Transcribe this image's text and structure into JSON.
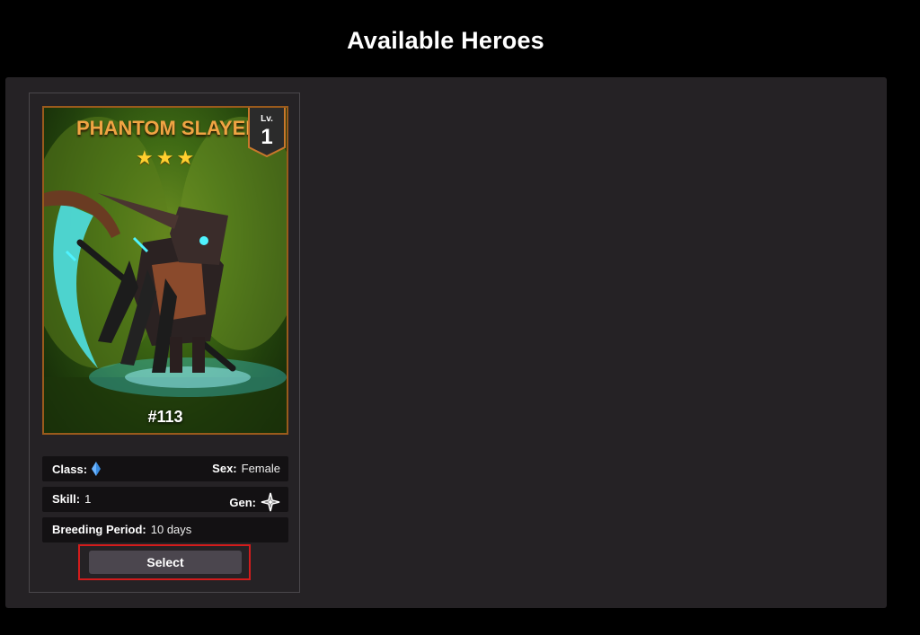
{
  "page": {
    "title": "Available Heroes"
  },
  "hero_card": {
    "name": "PHANTOM SLAYER",
    "stars": "★★★",
    "level_label": "Lv.",
    "level_value": "1",
    "hero_id": "#113",
    "stats": {
      "class_label": "Class:",
      "class_icon": "blue-crystal-icon",
      "sex_label": "Sex:",
      "sex_value": "Female",
      "skill_label": "Skill:",
      "skill_value": "1",
      "gen_label": "Gen:",
      "gen_icon": "gen-star-icon",
      "breeding_label": "Breeding Period:",
      "breeding_value": "10 days"
    },
    "select_label": "Select"
  },
  "colors": {
    "background": "#000000",
    "panel": "#252225",
    "name_accent": "#f0a443",
    "star": "#ffcf2e",
    "badge": "#2b2b2b",
    "badge_border": "#c9772b",
    "highlight_border": "#d21c1c",
    "button": "#4b464e",
    "class_icon": "#3a8ce0"
  }
}
